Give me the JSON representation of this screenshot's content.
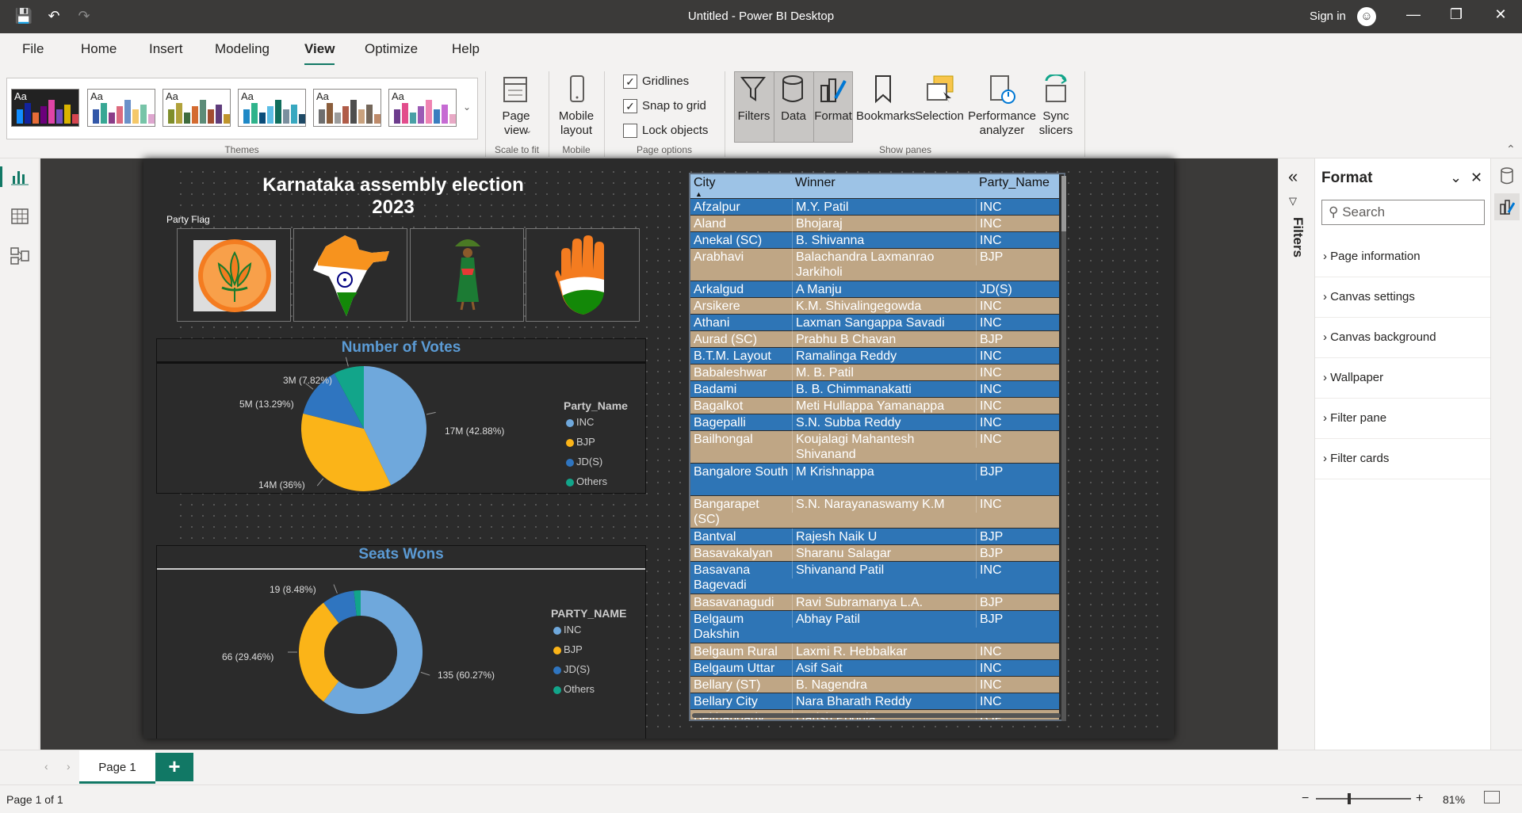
{
  "window": {
    "title": "Untitled - Power BI Desktop",
    "sign_in": "Sign in"
  },
  "menu": [
    "File",
    "Home",
    "Insert",
    "Modeling",
    "View",
    "Optimize",
    "Help"
  ],
  "ribbon": {
    "themes_label": "Themes",
    "page_view": "Page view",
    "mobile_layout": "Mobile layout",
    "scale_to_fit": "Scale to fit",
    "mobile": "Mobile",
    "gridlines": "Gridlines",
    "snap_to_grid": "Snap to grid",
    "lock_objects": "Lock objects",
    "page_options": "Page options",
    "filters": "Filters",
    "data": "Data",
    "format": "Format",
    "bookmarks": "Bookmarks",
    "selection": "Selection",
    "performance_analyzer": "Performance analyzer",
    "sync_slicers": "Sync slicers",
    "show_panes": "Show panes",
    "themes_aa": "Aa"
  },
  "report": {
    "title": "Karnataka assembly election 2023",
    "flag_label": "Party Flag",
    "votes": {
      "title": "Number of Votes",
      "legend_title": "Party_Name",
      "labels": [
        "17M (42.88%)",
        "14M (36%)",
        "5M (13.29%)",
        "3M (7.82%)"
      ]
    },
    "seats": {
      "title": "Seats Wons",
      "legend_title": "PARTY_NAME",
      "labels": [
        "135 (60.27%)",
        "66 (29.46%)",
        "19 (8.48%)"
      ]
    },
    "legend_items": [
      "INC",
      "BJP",
      "JD(S)",
      "Others"
    ],
    "colors": {
      "INC": "#6fa8dc",
      "BJP": "#fbb418",
      "JDS": "#2f75c0",
      "Others": "#12a58a"
    }
  },
  "chart_data": [
    {
      "type": "pie",
      "title": "Number of Votes",
      "legend_title": "Party_Name",
      "categories": [
        "INC",
        "BJP",
        "JD(S)",
        "Others"
      ],
      "values": [
        42.88,
        36,
        13.29,
        7.82
      ],
      "value_labels": [
        "17M",
        "14M",
        "5M",
        "3M"
      ]
    },
    {
      "type": "pie",
      "subtype": "donut",
      "title": "Seats Wons",
      "legend_title": "PARTY_NAME",
      "categories": [
        "INC",
        "BJP",
        "JD(S)",
        "Others"
      ],
      "values": [
        135,
        66,
        19,
        4
      ],
      "percent_labels": [
        "60.27%",
        "29.46%",
        "8.48%"
      ]
    }
  ],
  "table": {
    "headers": [
      "City",
      "Winner",
      "Party_Name"
    ],
    "rows": [
      [
        "Afzalpur",
        "M.Y. Patil",
        "INC"
      ],
      [
        "Aland",
        "Bhojaraj",
        "INC"
      ],
      [
        "Anekal (SC)",
        "B. Shivanna",
        "INC"
      ],
      [
        "Arabhavi",
        "Balachandra Laxmanrao Jarkiholi",
        "BJP"
      ],
      [
        "Arkalgud",
        "A Manju",
        "JD(S)"
      ],
      [
        "Arsikere",
        "K.M. Shivalingegowda",
        "INC"
      ],
      [
        "Athani",
        "Laxman Sangappa Savadi",
        "INC"
      ],
      [
        "Aurad (SC)",
        "Prabhu B Chavan",
        "BJP"
      ],
      [
        "B.T.M. Layout",
        "Ramalinga Reddy",
        "INC"
      ],
      [
        "Babaleshwar",
        "M. B. Patil",
        "INC"
      ],
      [
        "Badami",
        "B. B. Chimmanakatti",
        "INC"
      ],
      [
        "Bagalkot",
        "Meti Hullappa Yamanappa",
        "INC"
      ],
      [
        "Bagepalli",
        "S.N. Subba Reddy",
        "INC"
      ],
      [
        "Bailhongal",
        "Koujalagi Mahantesh Shivanand",
        "INC"
      ],
      [
        "Bangalore South",
        "M Krishnappa",
        "BJP"
      ],
      [
        "Bangarapet (SC)",
        "S.N. Narayanaswamy K.M",
        "INC"
      ],
      [
        "Bantval",
        "Rajesh Naik U",
        "BJP"
      ],
      [
        "Basavakalyan",
        "Sharanu Salagar",
        "BJP"
      ],
      [
        "Basavana Bagevadi",
        "Shivanand Patil",
        "INC"
      ],
      [
        "Basavanagudi",
        "Ravi Subramanya L.A.",
        "BJP"
      ],
      [
        "Belgaum Dakshin",
        "Abhay Patil",
        "BJP"
      ],
      [
        "Belgaum Rural",
        "Laxmi R. Hebbalkar",
        "INC"
      ],
      [
        "Belgaum Uttar",
        "Asif Sait",
        "INC"
      ],
      [
        "Bellary (ST)",
        "B. Nagendra",
        "INC"
      ],
      [
        "Bellary City",
        "Nara Bharath Reddy",
        "INC"
      ],
      [
        "Belthangady",
        "Harish Poonja",
        "BJP"
      ]
    ]
  },
  "format_pane": {
    "title": "Format",
    "search_placeholder": "Search",
    "sections": [
      "Page information",
      "Canvas settings",
      "Canvas background",
      "Wallpaper",
      "Filter pane",
      "Filter cards"
    ]
  },
  "filters_label": "Filters",
  "page_tab": "Page 1",
  "status": {
    "page": "Page 1 of 1",
    "zoom": "81%"
  }
}
